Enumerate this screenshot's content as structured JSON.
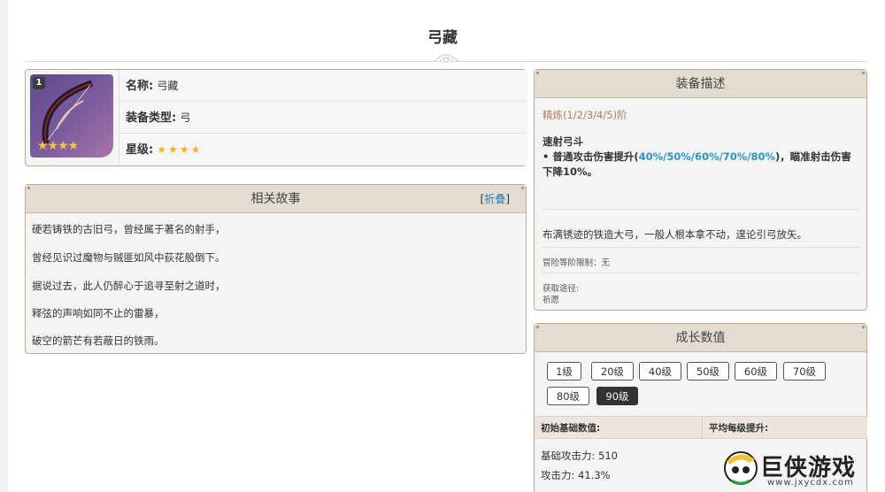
{
  "page": {
    "title": "弓藏"
  },
  "info": {
    "rank_badge": "1",
    "name_label": "名称:",
    "name_value": "弓藏",
    "type_label": "装备类型:",
    "type_value": "弓",
    "rarity_label": "星级:",
    "rarity": 4
  },
  "story": {
    "title": "相关故事",
    "fold_open": "[",
    "fold_link": "折叠",
    "fold_close": "]",
    "lines": [
      "硬若铸铁的古旧弓，曾经属于著名的射手，",
      "曾经见识过魔物与贼匪如风中荻花般倒下。",
      "据说过去，此人仍醉心于追寻至射之道时，",
      "释弦的声响如同不止的雷暴，",
      "破空的箭芒有若蔽日的铁雨。"
    ]
  },
  "description": {
    "title": "装备描述",
    "refine": "精炼(1/2/3/4/5)阶",
    "skill_name": "速射弓斗",
    "skill_prefix": "• 普通攻击伤害提升(",
    "skill_highlight": "40%/50%/60%/70%/80%",
    "skill_suffix": ")，瞄准射击伤害下降10%。",
    "flavor": "布满锈迹的铁造大弓，一般人根本拿不动，遑论引弓放矢。",
    "limit": "冒险等阶限制：无",
    "source_label": "获取途径:",
    "source_value": "祈愿"
  },
  "growth": {
    "title": "成长数值",
    "levels": [
      "1级",
      "20级",
      "40级",
      "50级",
      "60级",
      "70级",
      "80级",
      "90级"
    ],
    "active_level": "90级",
    "col_initial": "初始基础数值:",
    "col_avg": "平均每级提升:",
    "base_atk": "基础攻击力: 510",
    "atk_pct": "攻击力: 41.3%"
  },
  "watermark": {
    "text": "巨侠游戏",
    "url": "www.jxycdx.com"
  },
  "colors": {
    "accent_border": "#c2a88e",
    "header_bg": "#e3dcd2",
    "highlight": "#2a95c9",
    "refine": "#a87f5d",
    "star": "#f2b227"
  }
}
